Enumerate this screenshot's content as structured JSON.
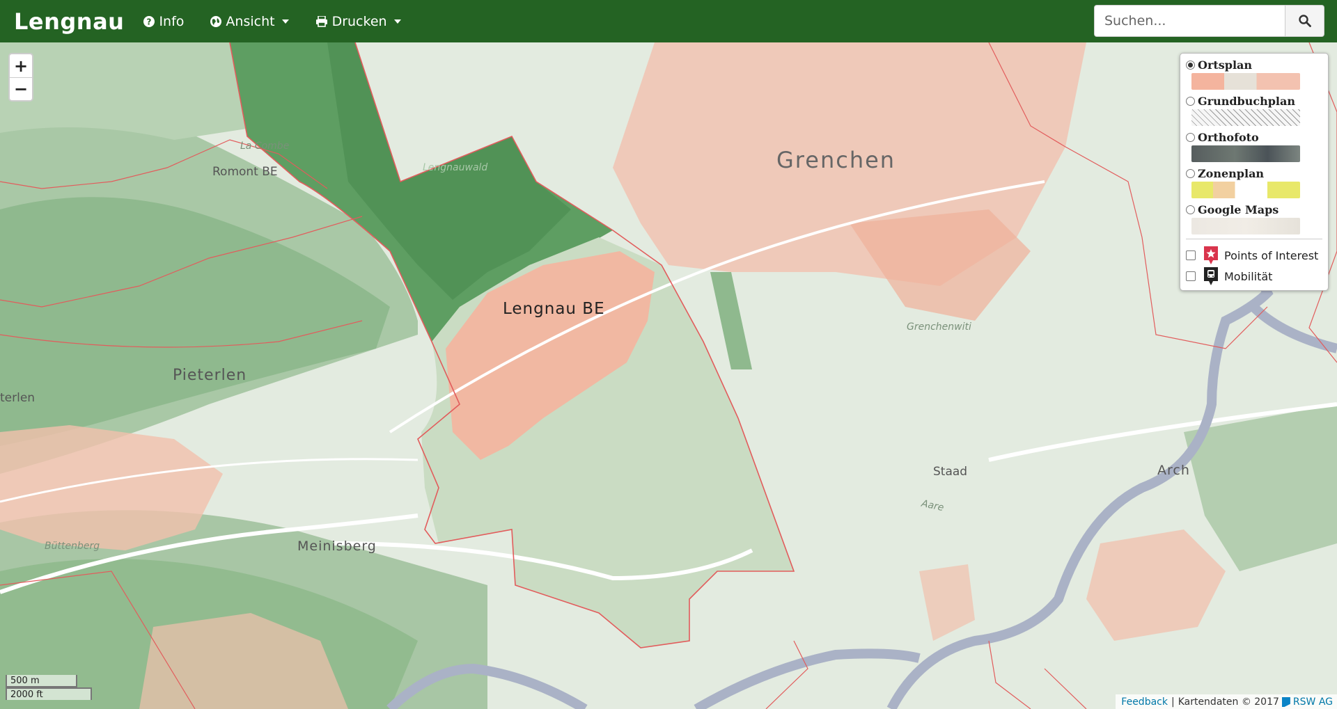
{
  "navbar": {
    "brand": "Lengnau",
    "info_label": "Info",
    "ansicht_label": "Ansicht",
    "drucken_label": "Drucken",
    "search_placeholder": "Suchen..."
  },
  "zoom": {
    "in": "+",
    "out": "−"
  },
  "layers": {
    "base": [
      {
        "label": "Ortsplan",
        "selected": true
      },
      {
        "label": "Grundbuchplan",
        "selected": false
      },
      {
        "label": "Orthofoto",
        "selected": false
      },
      {
        "label": "Zonenplan",
        "selected": false
      },
      {
        "label": "Google Maps",
        "selected": false
      }
    ],
    "overlays": [
      {
        "label": "Points of Interest",
        "checked": false,
        "icon": "star-marker-icon",
        "color": "#d9344c"
      },
      {
        "label": "Mobilität",
        "checked": false,
        "icon": "bus-marker-icon",
        "color": "#222222"
      }
    ]
  },
  "map_labels": {
    "grenchen": "Grenchen",
    "lengnau": "Lengnau BE",
    "romont": "Romont BE",
    "la_combe": "La Combe",
    "lengnauwald": "Lengnauwald",
    "pieterlen": "Pieterlen",
    "terlen": "terlen",
    "grenchenwiti": "Grenchenwiti",
    "staad": "Staad",
    "aare": "Aare",
    "arch": "Arch",
    "meinisberg": "Meinisberg",
    "buttenberg": "Büttenberg"
  },
  "scale": {
    "metric": "500 m",
    "imperial": "2000 ft"
  },
  "attribution": {
    "feedback": "Feedback",
    "separator": "|",
    "kartendaten": "Kartendaten © 2017",
    "company": "RSW AG"
  },
  "colors": {
    "navbar": "#246323",
    "boundary": "#e05555",
    "settlement": "#f0a08a",
    "forest": "#5d9a62",
    "river": "#a9b2c6"
  }
}
